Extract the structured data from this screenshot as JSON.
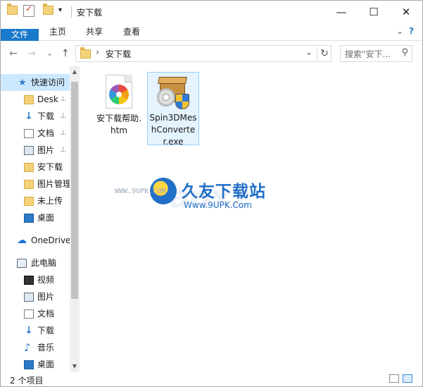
{
  "window": {
    "title": "安下载",
    "controls": {
      "minimize": "—",
      "maximize": "☐",
      "close": "✕"
    },
    "quick_access_toolbar": {
      "dropdown": "▾"
    }
  },
  "ribbon": {
    "tabs": [
      "文件",
      "主页",
      "共享",
      "查看"
    ],
    "collapse_glyph": "⌄",
    "help_glyph": "?"
  },
  "address_bar": {
    "back": "←",
    "forward": "→",
    "recent": "⌄",
    "up": "↑",
    "separator": "›",
    "breadcrumb": "安下载",
    "dropdown": "⌄",
    "refresh": "↻",
    "search_placeholder": "搜索\"安下...",
    "search_icon": "⚲"
  },
  "nav_pane": {
    "items": [
      {
        "label": "快速访问",
        "icon": "star-icon",
        "pinned": false,
        "selected": true
      },
      {
        "label": "Desk",
        "icon": "folder-icon",
        "pinned": true
      },
      {
        "label": "下载",
        "icon": "download-icon",
        "pinned": true
      },
      {
        "label": "文档",
        "icon": "document-icon",
        "pinned": true
      },
      {
        "label": "图片",
        "icon": "picture-icon",
        "pinned": true
      },
      {
        "label": "安下载",
        "icon": "folder-icon",
        "pinned": false
      },
      {
        "label": "图片管理",
        "icon": "folder-icon",
        "pinned": false
      },
      {
        "label": "未上传",
        "icon": "folder-icon",
        "pinned": false
      },
      {
        "label": "桌面",
        "icon": "desktop-icon",
        "pinned": false
      },
      {
        "label": "OneDrive",
        "icon": "cloud-icon",
        "pinned": false
      },
      {
        "label": "此电脑",
        "icon": "computer-icon",
        "pinned": false
      },
      {
        "label": "视频",
        "icon": "video-icon",
        "pinned": false
      },
      {
        "label": "图片",
        "icon": "picture-icon",
        "pinned": false
      },
      {
        "label": "文档",
        "icon": "document-icon",
        "pinned": false
      },
      {
        "label": "下载",
        "icon": "download-icon",
        "pinned": false
      },
      {
        "label": "音乐",
        "icon": "music-icon",
        "pinned": false
      },
      {
        "label": "桌面",
        "icon": "desktop-icon",
        "pinned": false
      }
    ],
    "pin_glyph": "📌",
    "scroll_up": "▲",
    "scroll_down": "▼"
  },
  "files": [
    {
      "name": "安下载帮助.htm",
      "icon": "htm-file-icon",
      "selected": false
    },
    {
      "name": "Spin3DMeshConverter.exe",
      "icon": "installer-exe-icon",
      "selected": true
    }
  ],
  "watermark": {
    "brand": "久友下载站",
    "url_main": "Www.9UPK.Com",
    "url_small": "WWW.9UPK.COM",
    "ghost_text": "anxz"
  },
  "status_bar": {
    "item_count": "2 个项目"
  }
}
